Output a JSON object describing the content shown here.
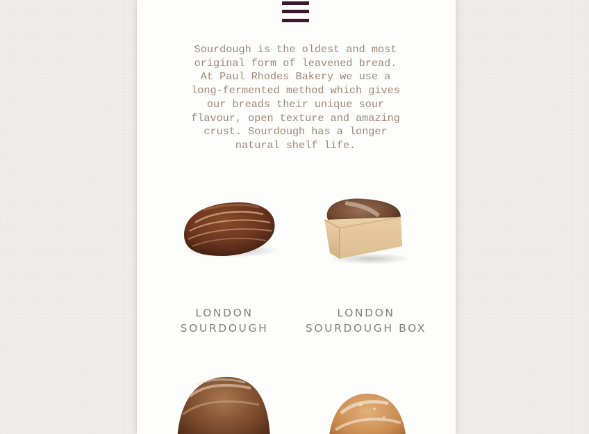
{
  "menu": {
    "icon": "hamburger-menu-icon"
  },
  "intro": {
    "text": "Sourdough is the oldest and most\noriginal form of leavened bread.\nAt Paul Rhodes Bakery we use a\nlong-fermented method which gives\nour breads their unique sour\nflavour, open texture and amazing\ncrust. Sourdough has a longer\nnatural shelf life."
  },
  "products": [
    {
      "name": "LONDON\nSOURDOUGH",
      "image": "sourdough-loaf"
    },
    {
      "name": "LONDON\nSOURDOUGH BOX",
      "image": "sourdough-box-loaf"
    },
    {
      "name": "",
      "image": "round-loaf"
    },
    {
      "name": "",
      "image": "white-bloomer"
    }
  ],
  "colors": {
    "background": "#efedea",
    "panel": "#fdfdfc",
    "menu_icon": "#3a1830",
    "intro_text": "#9c8878",
    "product_name": "#7f7f7f"
  }
}
